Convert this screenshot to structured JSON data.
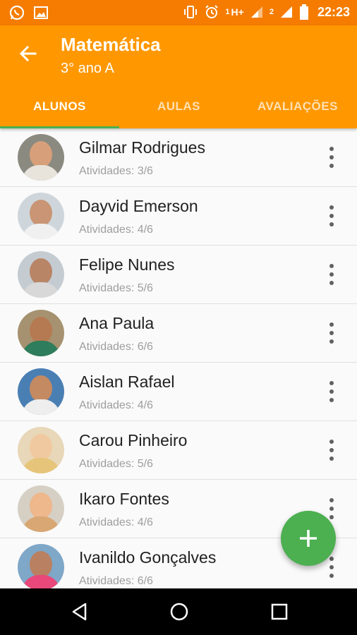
{
  "status_bar": {
    "sim1": "1",
    "network": "H+",
    "sim2": "2",
    "time": "22:23"
  },
  "app_bar": {
    "title": "Matemática",
    "subtitle": "3° ano A"
  },
  "tabs": [
    {
      "label": "ALUNOS",
      "active": true
    },
    {
      "label": "AULAS",
      "active": false
    },
    {
      "label": "AVALIAÇÕES",
      "active": false
    }
  ],
  "students": [
    {
      "name": "Gilmar Rodrigues",
      "activities": "Atividades: 3/6",
      "skin": "#d7a07a",
      "shirt": "#e8e4dc",
      "bg": "#8a8a80"
    },
    {
      "name": "Dayvid Emerson",
      "activities": "Atividades: 4/6",
      "skin": "#c99574",
      "shirt": "#f0f0f0",
      "bg": "#cfd6db"
    },
    {
      "name": "Felipe Nunes",
      "activities": "Atividades: 5/6",
      "skin": "#b98567",
      "shirt": "#d8d8d8",
      "bg": "#c4ccd2"
    },
    {
      "name": "Ana Paula",
      "activities": "Atividades: 6/6",
      "skin": "#b57a52",
      "shirt": "#2e7d5c",
      "bg": "#a69270"
    },
    {
      "name": "Aislan Rafael",
      "activities": "Atividades: 4/6",
      "skin": "#c48a62",
      "shirt": "#eeeeee",
      "bg": "#4a7fb4"
    },
    {
      "name": "Carou Pinheiro",
      "activities": "Atividades: 5/6",
      "skin": "#f0c9a0",
      "shirt": "#e6c57a",
      "bg": "#e8d7b8"
    },
    {
      "name": "Ikaro Fontes",
      "activities": "Atividades: 4/6",
      "skin": "#eeb78c",
      "shirt": "#d9a774",
      "bg": "#d6cfc4"
    },
    {
      "name": "Ivanildo Gonçalves",
      "activities": "Atividades: 6/6",
      "skin": "#b98061",
      "shirt": "#e8487a",
      "bg": "#7fa7c8"
    }
  ],
  "colors": {
    "status_bar": "#f57c00",
    "app_bar": "#ff9800",
    "tab_indicator": "#4caf50",
    "fab": "#4caf50"
  },
  "icons": {
    "back": "arrow-left-icon",
    "more": "more-vert-icon",
    "fab": "plus-icon"
  }
}
